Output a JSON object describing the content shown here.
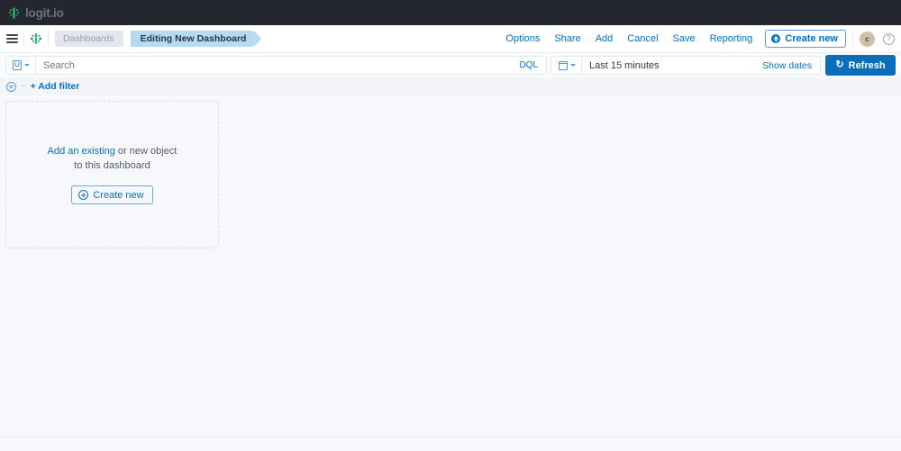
{
  "brand": {
    "name": "logit.io",
    "mark": "logit-leaf-icon"
  },
  "nav": {
    "menu_icon": "hamburger-menu-icon",
    "app_icon": "logit-puzzle-icon",
    "breadcrumbs": [
      {
        "label": "Dashboards",
        "active": false
      },
      {
        "label": "Editing New Dashboard",
        "active": true
      }
    ],
    "links": [
      {
        "label": "Options"
      },
      {
        "label": "Share"
      },
      {
        "label": "Add"
      },
      {
        "label": "Cancel"
      },
      {
        "label": "Save"
      },
      {
        "label": "Reporting"
      }
    ],
    "create_new_label": "Create new",
    "avatar_initial": "c",
    "help_glyph": "?"
  },
  "query": {
    "dataset_icon": "saved-dataset-icon",
    "search_placeholder": "Search",
    "search_value": "",
    "dql_label": "DQL",
    "calendar_icon": "calendar-icon",
    "time_range": "Last 15 minutes",
    "show_dates_label": "Show dates",
    "refresh_label": "Refresh",
    "refresh_glyph": "↻"
  },
  "filters": {
    "funnel_icon": "filter-funnel-icon",
    "separator": "–",
    "add_filter_label": "+ Add filter"
  },
  "panel": {
    "link_text": "Add an existing",
    "text_rest": " or new object",
    "text_line2": "to this dashboard",
    "create_new_label": "Create new"
  },
  "colors": {
    "topbar_bg": "#25272e",
    "accent_blue": "#0071c2",
    "refresh_bg": "#0a6ebd",
    "crumb_active_bg": "#b5dbf2",
    "crumb_inactive_bg": "#e3e6ec",
    "brand_green": "#2fbf71",
    "avatar_bg": "#cdbfa8",
    "canvas_bg": "#f7f8fc"
  }
}
